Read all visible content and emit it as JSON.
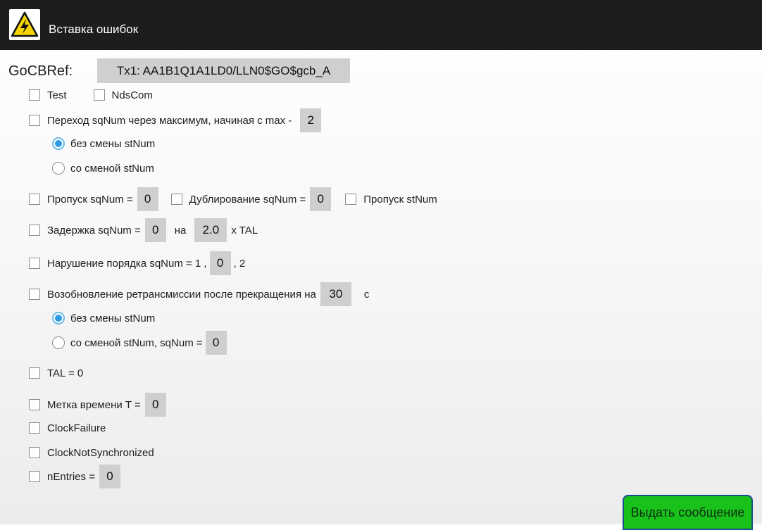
{
  "titlebar": {
    "title": "Вставка ошибок",
    "icon": "high-voltage-warning-icon"
  },
  "gocb": {
    "label": "GoCBRef:",
    "value": "Tx1: AA1B1Q1A1LD0/LLN0$GO$gcb_A"
  },
  "flags": {
    "test": "Test",
    "ndscom": "NdsCom"
  },
  "sqnum_rollover": {
    "label": "Переход sqNum через максимум, начиная с max -",
    "value": "2",
    "opt_keep": "без смены stNum",
    "opt_change": "со сменой stNum"
  },
  "skip_sqnum": {
    "label": "Пропуск sqNum =",
    "value": "0"
  },
  "dup_sqnum": {
    "label": "Дублирование sqNum =",
    "value": "0"
  },
  "skip_stnum": {
    "label": "Пропуск stNum"
  },
  "delay_sqnum": {
    "label": "Задержка sqNum =",
    "value": "0",
    "by": "на",
    "factor": "2.0",
    "unit": "x TAL"
  },
  "order": {
    "label": "Нарушение порядка sqNum = 1 ,",
    "value": "0",
    "tail": ", 2"
  },
  "resume": {
    "label": "Возобновление ретрансмиссии после прекращения на",
    "value": "30",
    "unit": "с",
    "opt_keep": "без смены stNum",
    "opt_change": "со сменой stNum, sqNum =",
    "opt_change_value": "0"
  },
  "tal": {
    "label": "TAL = 0"
  },
  "timestamp": {
    "label": "Метка времени T =",
    "value": "0"
  },
  "clock_failure": {
    "label": "ClockFailure"
  },
  "clock_not_sync": {
    "label": "ClockNotSynchronized"
  },
  "nentries": {
    "label": "nEntries =",
    "value": "0"
  },
  "actions": {
    "issue": "Выдать сообщение"
  },
  "colors": {
    "titlebar": "#1d1d1d",
    "field": "#cfcfcf",
    "radio_selected": "#2f9ae4",
    "button": "#19c21b",
    "button_border": "#1b4f8c"
  }
}
